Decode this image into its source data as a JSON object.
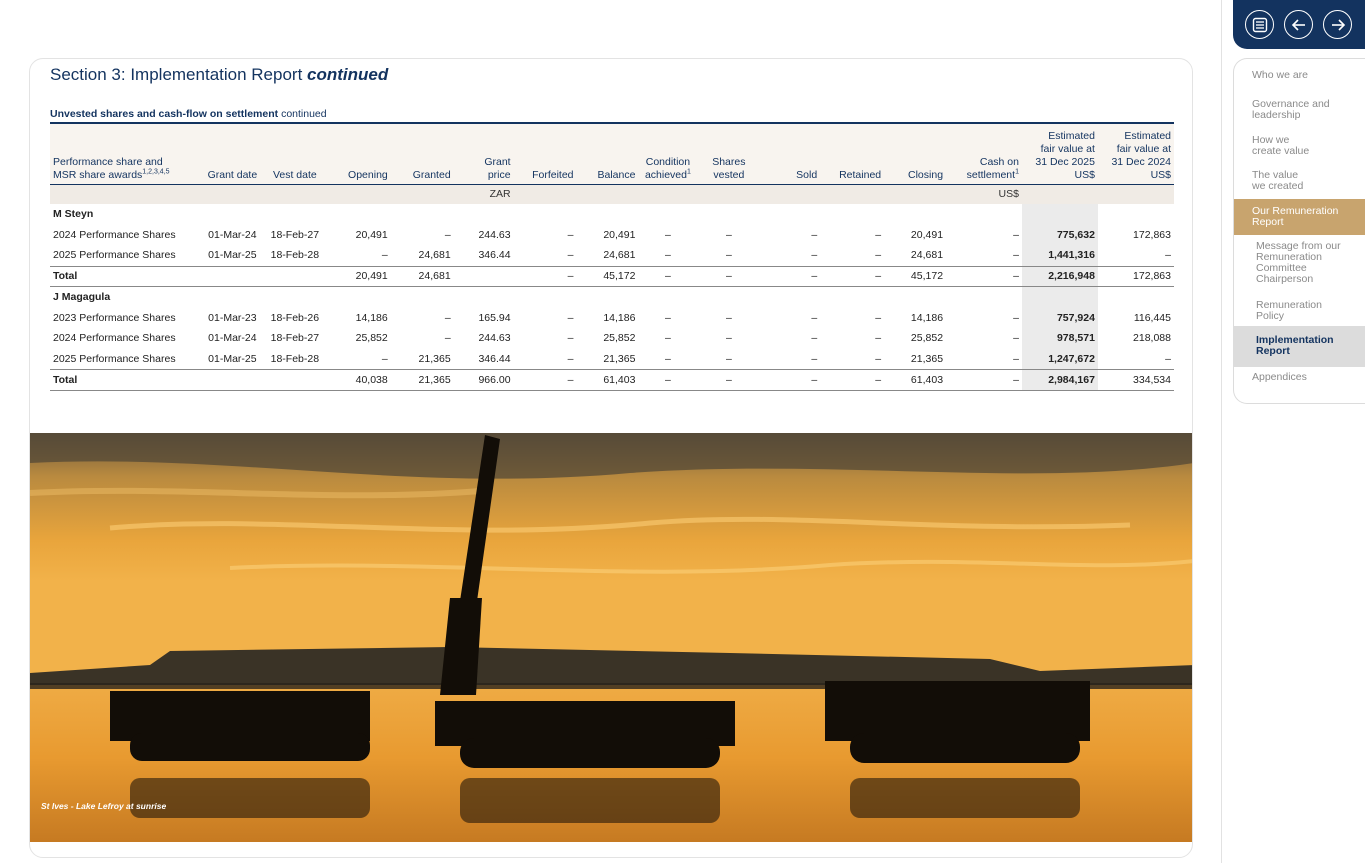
{
  "page": {
    "section_title": "Section 3: Implementation Report",
    "section_title_suffix": "continued",
    "subtitle_bold": "Unvested shares and cash-flow on settlement",
    "subtitle_rest": "continued"
  },
  "table": {
    "headers": {
      "award_line1": "Performance share and",
      "award_line2": "MSR share awards",
      "award_sup": "1,2,3,4,5",
      "grant_date": "Grant date",
      "vest_date": "Vest date",
      "opening": "Opening",
      "granted": "Granted",
      "grant_price_line1": "Grant",
      "grant_price_line2": "price",
      "forfeited": "Forfeited",
      "balance": "Balance",
      "condition_line1": "Condition",
      "condition_line2": "achieved",
      "condition_sup": "1",
      "shares_vested_line1": "Shares",
      "shares_vested_line2": "vested",
      "sold": "Sold",
      "retained": "Retained",
      "closing": "Closing",
      "cash_line1": "Cash on",
      "cash_line2": "settlement",
      "cash_sup": "1",
      "est25_line1": "Estimated",
      "est25_line2": "fair value at",
      "est25_line3": "31 Dec 2025",
      "est25_line4": "US$",
      "est24_line1": "Estimated",
      "est24_line2": "fair value at",
      "est24_line3": "31 Dec 2024",
      "est24_line4": "US$"
    },
    "units": {
      "grant_price": "ZAR",
      "cash": "US$"
    },
    "person1": {
      "name": "M Steyn",
      "rows": [
        {
          "award": "2024 Performance Shares",
          "grant_date": "01-Mar-24",
          "vest_date": "18-Feb-27",
          "opening": "20,491",
          "granted": "–",
          "grant_price": "244.63",
          "forfeited": "–",
          "balance": "20,491",
          "condition": "–",
          "vested": "–",
          "sold": "–",
          "retained": "–",
          "closing": "20,491",
          "cash": "–",
          "est25": "775,632",
          "est24": "172,863"
        },
        {
          "award": "2025 Performance Shares",
          "grant_date": "01-Mar-25",
          "vest_date": "18-Feb-28",
          "opening": "–",
          "granted": "24,681",
          "grant_price": "346.44",
          "forfeited": "–",
          "balance": "24,681",
          "condition": "–",
          "vested": "–",
          "sold": "–",
          "retained": "–",
          "closing": "24,681",
          "cash": "–",
          "est25": "1,441,316",
          "est24": "–"
        }
      ],
      "total": {
        "label": "Total",
        "opening": "20,491",
        "granted": "24,681",
        "grant_price": "",
        "forfeited": "–",
        "balance": "45,172",
        "condition": "–",
        "vested": "–",
        "sold": "–",
        "retained": "–",
        "closing": "45,172",
        "cash": "–",
        "est25": "2,216,948",
        "est24": "172,863"
      }
    },
    "person2": {
      "name": "J Magagula",
      "rows": [
        {
          "award": "2023 Performance Shares",
          "grant_date": "01-Mar-23",
          "vest_date": "18-Feb-26",
          "opening": "14,186",
          "granted": "–",
          "grant_price": "165.94",
          "forfeited": "–",
          "balance": "14,186",
          "condition": "–",
          "vested": "–",
          "sold": "–",
          "retained": "–",
          "closing": "14,186",
          "cash": "–",
          "est25": "757,924",
          "est24": "116,445"
        },
        {
          "award": "2024 Performance Shares",
          "grant_date": "01-Mar-24",
          "vest_date": "18-Feb-27",
          "opening": "25,852",
          "granted": "–",
          "grant_price": "244.63",
          "forfeited": "–",
          "balance": "25,852",
          "condition": "–",
          "vested": "–",
          "sold": "–",
          "retained": "–",
          "closing": "25,852",
          "cash": "–",
          "est25": "978,571",
          "est24": "218,088"
        },
        {
          "award": "2025 Performance Shares",
          "grant_date": "01-Mar-25",
          "vest_date": "18-Feb-28",
          "opening": "–",
          "granted": "21,365",
          "grant_price": "346.44",
          "forfeited": "–",
          "balance": "21,365",
          "condition": "–",
          "vested": "–",
          "sold": "–",
          "retained": "–",
          "closing": "21,365",
          "cash": "–",
          "est25": "1,247,672",
          "est24": "–"
        }
      ],
      "total": {
        "label": "Total",
        "opening": "40,038",
        "granted": "21,365",
        "grant_price": "966.00",
        "forfeited": "–",
        "balance": "61,403",
        "condition": "–",
        "vested": "–",
        "sold": "–",
        "retained": "–",
        "closing": "61,403",
        "cash": "–",
        "est25": "2,984,167",
        "est24": "334,534"
      }
    }
  },
  "photo": {
    "caption": "St Ives - Lake Lefroy at sunrise"
  },
  "sidebar": {
    "buttons": {
      "contents_icon": "list-icon",
      "back_icon": "arrow-left-icon",
      "forward_icon": "arrow-right-icon"
    },
    "items": [
      {
        "label": "Who we are"
      },
      {
        "label": "Governance and\nleadership"
      },
      {
        "label": "How we\ncreate value"
      },
      {
        "label": "The value\nwe created"
      },
      {
        "label": "Our Remuneration\nReport"
      },
      {
        "label": "Message from our\nRemuneration\nCommittee\nChairperson"
      },
      {
        "label": "Remuneration\nPolicy"
      },
      {
        "label": "Implementation\nReport"
      },
      {
        "label": "Appendices"
      }
    ]
  },
  "colors": {
    "navy": "#13335f",
    "gold": "#c8a46e",
    "header_bg": "#f8f4ef",
    "highlight_col": "#ebebeb"
  }
}
